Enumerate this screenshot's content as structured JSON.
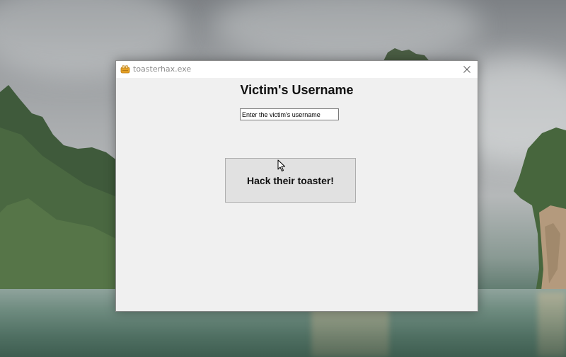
{
  "window": {
    "title": "toasterhax.exe",
    "icon": "toaster-icon",
    "close_icon": "close-icon"
  },
  "form": {
    "heading": "Victim's Username",
    "username_value": "Enter the victim's username",
    "hack_button_label": "Hack their toaster!"
  },
  "colors": {
    "window_background": "#f0f0f0",
    "titlebar_background": "#ffffff",
    "button_background": "#e1e1e1",
    "button_border": "#adadad"
  }
}
